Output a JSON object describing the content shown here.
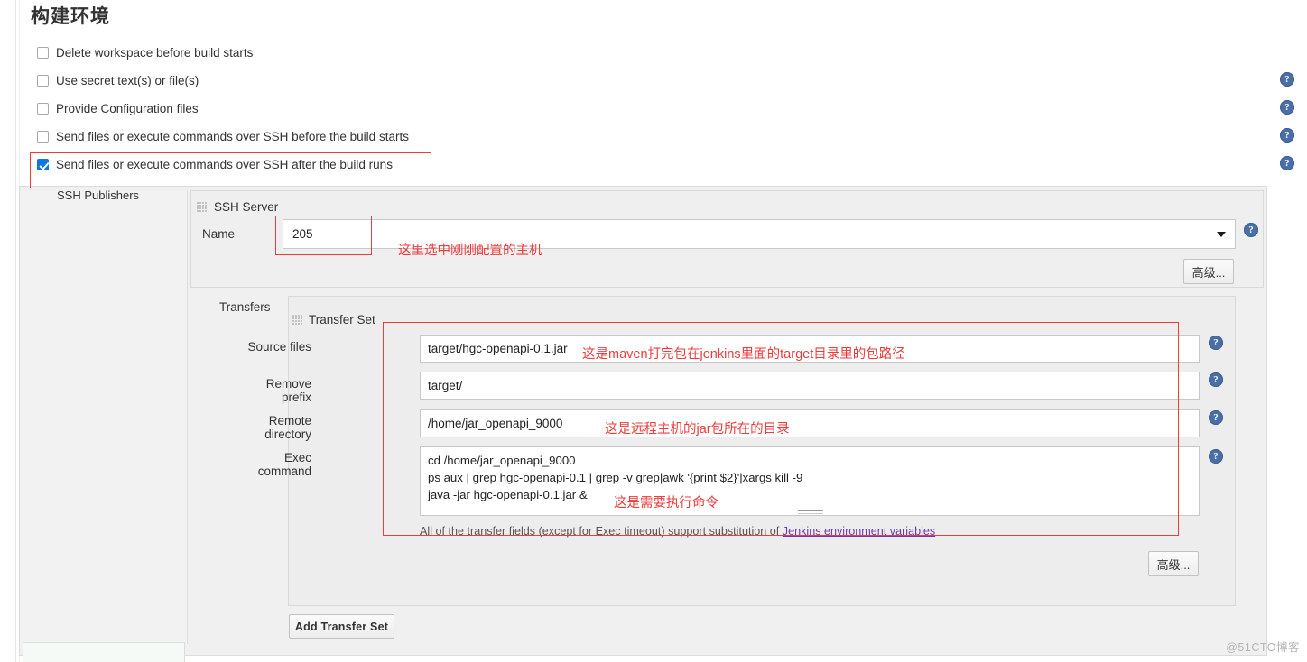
{
  "page": {
    "title": "构建环境",
    "watermark": "@51CTO博客"
  },
  "checkboxes": [
    {
      "label": "Delete workspace before build starts",
      "checked": false
    },
    {
      "label": "Use secret text(s) or file(s)",
      "checked": false
    },
    {
      "label": "Provide Configuration files",
      "checked": false
    },
    {
      "label": "Send files or execute commands over SSH before the build starts",
      "checked": false
    },
    {
      "label": "Send files or execute commands over SSH after the build runs",
      "checked": true
    }
  ],
  "publishers": {
    "label": "SSH Publishers",
    "ssh_server": {
      "title": "SSH Server",
      "name_label": "Name",
      "name_value": "205",
      "advanced_label": "高级..."
    },
    "transfers": {
      "label": "Transfers",
      "transfer_set_title": "Transfer Set",
      "fields": [
        {
          "label": "Source files",
          "value": "target/hgc-openapi-0.1.jar"
        },
        {
          "label": "Remove prefix",
          "value": "target/"
        },
        {
          "label": "Remote directory",
          "value": "/home/jar_openapi_9000"
        }
      ],
      "exec": {
        "label": "Exec command",
        "value": "cd /home/jar_openapi_9000\nps aux | grep hgc-openapi-0.1 | grep -v grep|awk '{print $2}'|xargs kill -9\njava -jar hgc-openapi-0.1.jar &"
      },
      "note_prefix": "All of the transfer fields (except for Exec timeout) support substitution of ",
      "note_link": "Jenkins environment variables",
      "advanced_label": "高级...",
      "add_transfer_set_label": "Add Transfer Set"
    }
  },
  "annotations": [
    {
      "text": "这里选中刚刚配置的主机"
    },
    {
      "text": "这是maven打完包在jenkins里面的target目录里的包路径"
    },
    {
      "text": "这是远程主机的jar包所在的目录"
    },
    {
      "text": "这是需要执行命令"
    }
  ],
  "icons": {
    "help": "help-icon",
    "chevron": "chevron-down-icon",
    "grip": "drag-grip-icon"
  },
  "colors": {
    "accent": "#0b78e3",
    "annotation": "#ef3b3b",
    "help": "#4a6fa5",
    "link": "#6a3ab2"
  }
}
